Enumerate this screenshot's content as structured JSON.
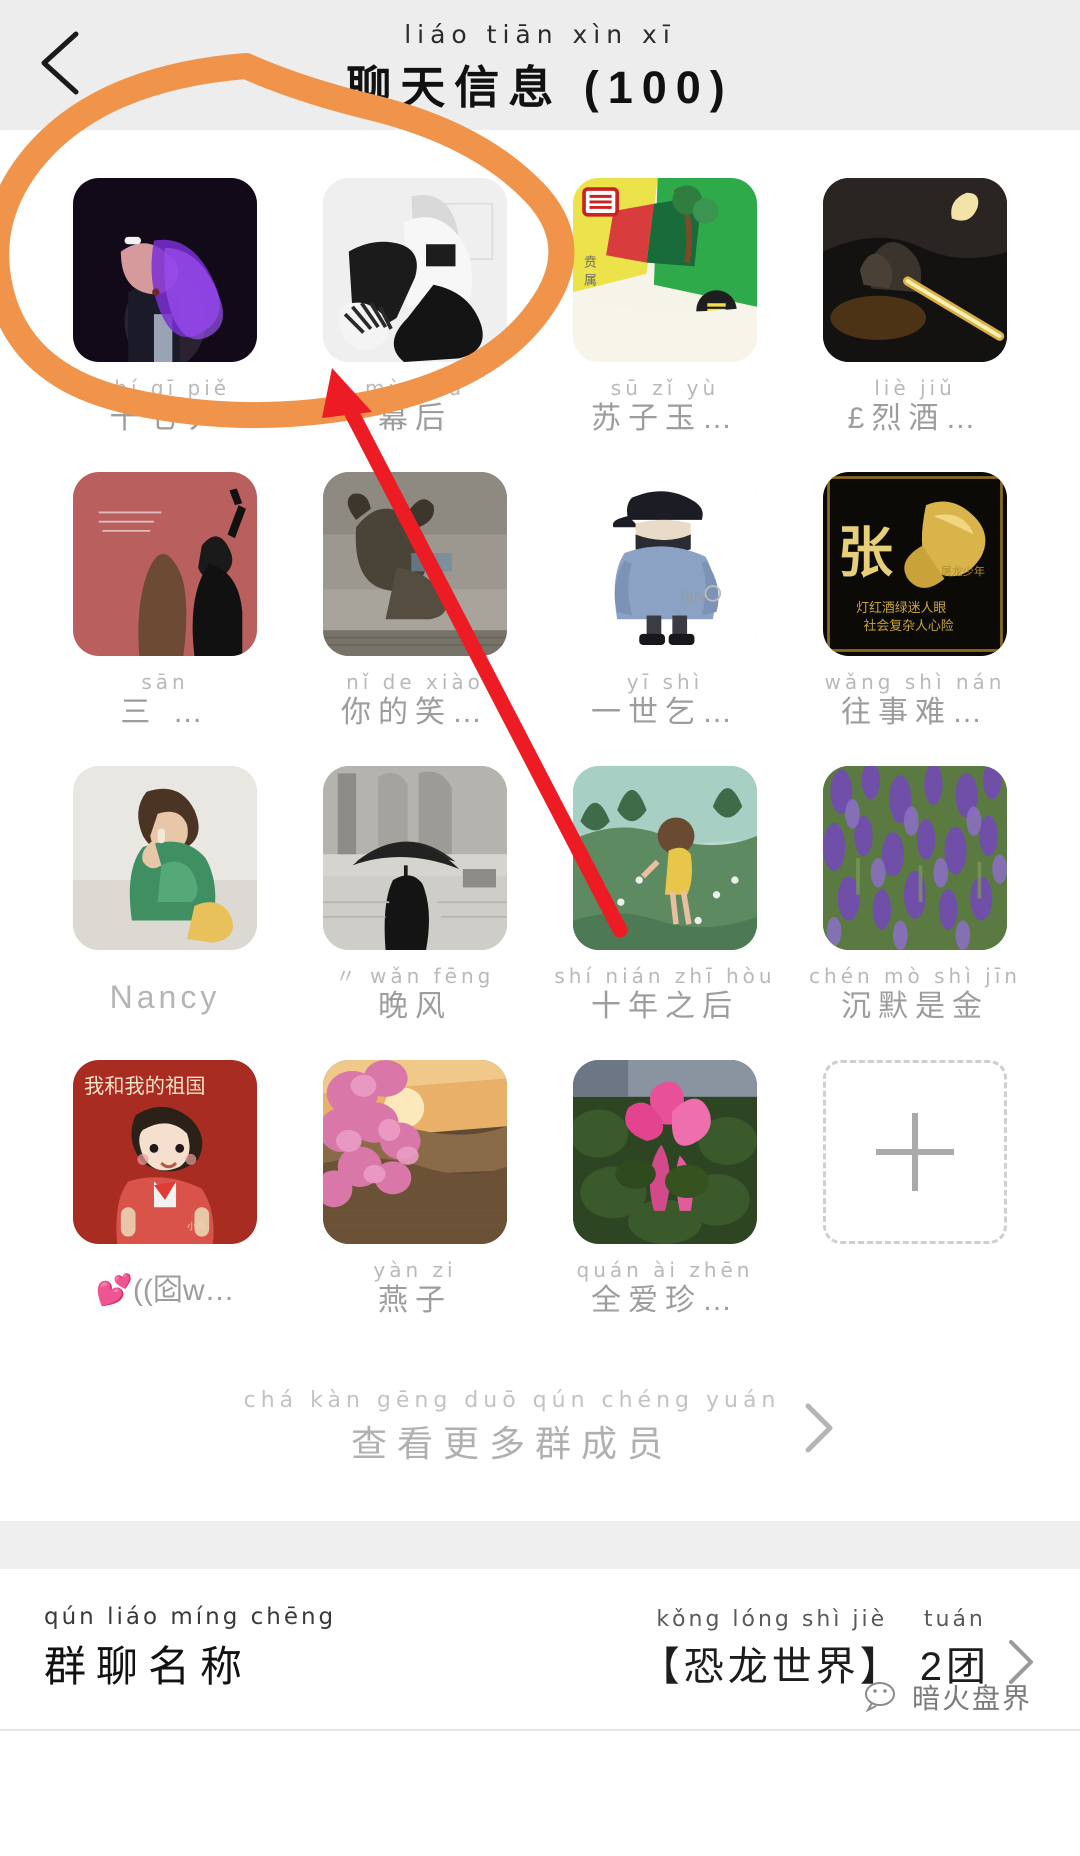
{
  "header": {
    "back_icon": "chevron-left-icon",
    "title_pinyin": "liáo tiān xìn xī",
    "title_han": "聊天信息 (100)"
  },
  "members": [
    {
      "pinyin": "shí qī piě",
      "han": "十七丿",
      "avatar": "man-smoking-purple"
    },
    {
      "pinyin": "mù hòu",
      "han": "幕后",
      "avatar": "bw-person-sitting"
    },
    {
      "pinyin": "sū zǐ yù",
      "han": "苏子玉…",
      "avatar": "colorful-abstract-poster"
    },
    {
      "pinyin": "liè jiǔ",
      "han": "£烈酒…",
      "avatar": "dark-moon-scene"
    },
    {
      "pinyin": "sān",
      "han": "三    …",
      "avatar": "girl-red-wall"
    },
    {
      "pinyin": "nǐ  de  xiào",
      "han": "你的笑…",
      "avatar": "bull-street"
    },
    {
      "pinyin": "yī  shì",
      "han": "一世乞…",
      "avatar": "cartoon-boy-cap"
    },
    {
      "pinyin": "wǎng shì nán",
      "han": "往事难…",
      "avatar": "gold-eagle-zhang"
    },
    {
      "pinyin": "",
      "han": "Nancy",
      "avatar": "toddler-girl",
      "style": "latin"
    },
    {
      "pinyin": "〃    wǎn fēng",
      "han": "晚风",
      "avatar": "bw-umbrella"
    },
    {
      "pinyin": "shí nián zhī hòu",
      "han": "十年之后",
      "avatar": "illustrated-girl-garden"
    },
    {
      "pinyin": "chén mò shì jīn",
      "han": "沉默是金",
      "avatar": "purple-flowers-field"
    },
    {
      "pinyin": "",
      "han": "💕((囵w…",
      "avatar": "cartoon-patriotic-girl",
      "style": "emoji"
    },
    {
      "pinyin": "yàn zi",
      "han": "燕子",
      "avatar": "pink-blossom-sunset"
    },
    {
      "pinyin": "quán ài zhēn",
      "han": "全爱珍…",
      "avatar": "pink-cyclamen"
    },
    {
      "pinyin": "",
      "han": "",
      "avatar": "add-member-button",
      "style": "add"
    }
  ],
  "more_members": {
    "pinyin": "chá kàn gēng duō qún chéng yuán",
    "han": "查看更多群成员",
    "chevron": "chevron-right-icon"
  },
  "group_name_row": {
    "label_pinyin": "qún liáo míng chēng",
    "label_han": "群聊名称",
    "value_pinyin": "kǒng lóng shì jiè",
    "value_han": "【恐龙世界】",
    "value2_pinyin": "tuán",
    "value2_han": "2团",
    "chevron": "chevron-right-icon"
  },
  "watermark": {
    "icon": "wechat-logo-icon",
    "text": "暗火盘界"
  },
  "colors": {
    "header_bg": "#ededed",
    "marker_orange": "#F0944B",
    "arrow_red": "#ED1C24",
    "label_gray": "#9d9d9d"
  }
}
